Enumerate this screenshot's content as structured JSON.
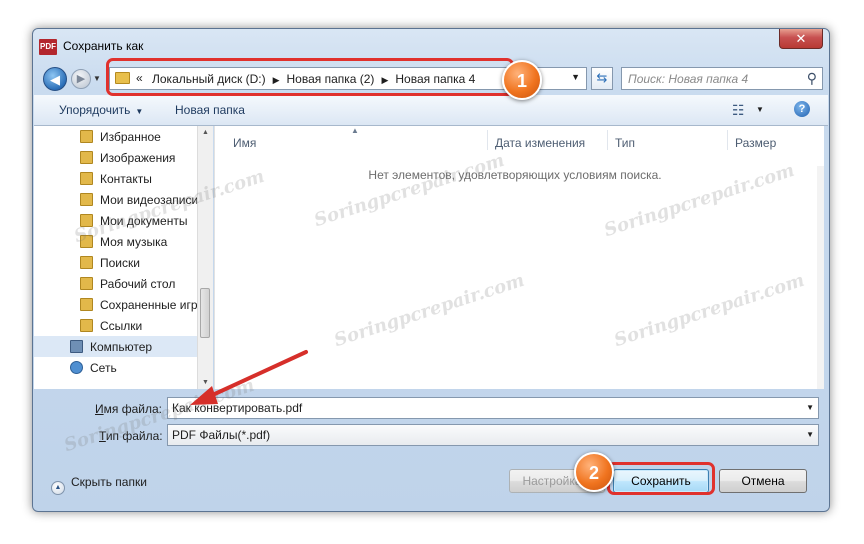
{
  "window": {
    "title": "Сохранить как",
    "app_icon_text": "PDF",
    "close_glyph": "✕"
  },
  "navigation": {
    "back_glyph": "◀",
    "forward_glyph": "▶",
    "address": {
      "overflow_glyph": "«",
      "crumbs": [
        "Локальный диск (D:)",
        "Новая папка (2)",
        "Новая папка 4"
      ]
    },
    "search_placeholder": "Поиск: Новая папка 4"
  },
  "toolbar": {
    "organize_label": "Упорядочить",
    "new_folder_label": "Новая папка"
  },
  "sidebar": {
    "items": [
      {
        "label": "Избранное",
        "icon": "star-folder-icon",
        "indent": 1
      },
      {
        "label": "Изображения",
        "icon": "pictures-folder-icon",
        "indent": 1
      },
      {
        "label": "Контакты",
        "icon": "contacts-folder-icon",
        "indent": 1
      },
      {
        "label": "Мои видеозаписи",
        "icon": "videos-folder-icon",
        "indent": 1
      },
      {
        "label": "Мои документы",
        "icon": "documents-folder-icon",
        "indent": 1
      },
      {
        "label": "Моя музыка",
        "icon": "music-folder-icon",
        "indent": 1
      },
      {
        "label": "Поиски",
        "icon": "searches-folder-icon",
        "indent": 1
      },
      {
        "label": "Рабочий стол",
        "icon": "desktop-folder-icon",
        "indent": 1
      },
      {
        "label": "Сохраненные игры",
        "icon": "saved-games-folder-icon",
        "indent": 1
      },
      {
        "label": "Ссылки",
        "icon": "links-folder-icon",
        "indent": 1
      },
      {
        "label": "Компьютер",
        "icon": "computer-icon",
        "indent": 0
      },
      {
        "label": "Сеть",
        "icon": "network-icon",
        "indent": 0
      }
    ]
  },
  "file_list": {
    "columns": [
      "Имя",
      "Дата изменения",
      "Тип",
      "Размер"
    ],
    "empty_message": "Нет элементов, удовлетворяющих условиям поиска."
  },
  "form": {
    "filename_label_u": "И",
    "filename_label_rest": "мя файла:",
    "filename_value": "Как конвертировать.pdf",
    "filetype_label_u": "Т",
    "filetype_label_rest": "ип файла:",
    "filetype_value": "PDF Файлы(*.pdf)"
  },
  "footer": {
    "hide_folders_label": "Скрыть папки",
    "settings_label": "Настройка...",
    "save_label": "Сохранить",
    "cancel_label": "Отмена"
  },
  "callouts": {
    "badge1": "1",
    "badge2": "2",
    "accent_color": "#e0312d",
    "badge_color": "#f0741f"
  },
  "watermark_text": "Soringpcrepair.com"
}
